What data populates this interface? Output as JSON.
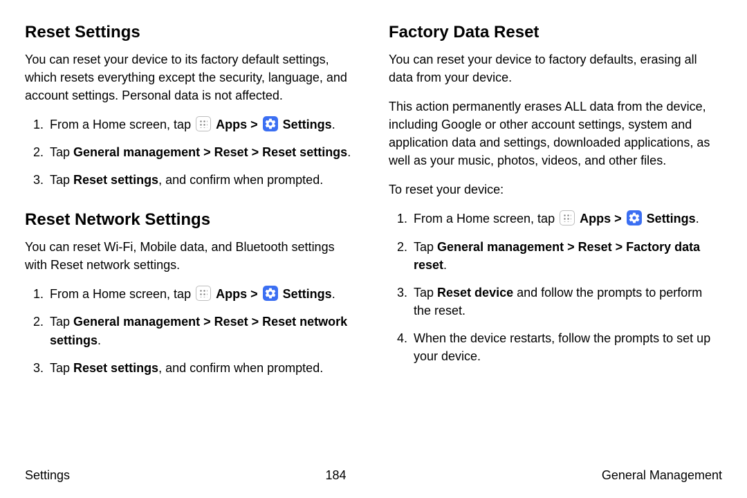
{
  "left": {
    "s1": {
      "heading": "Reset Settings",
      "intro": "You can reset your device to its factory default settings, which resets everything except the security, language, and account settings. Personal data is not affected.",
      "steps": {
        "st1_pre": "From a Home screen, tap",
        "st1_apps": "Apps",
        "st1_settings": "Settings",
        "st2_pre": "Tap ",
        "st2_bold": "General management > Reset > Reset settings",
        "st3_pre": "Tap ",
        "st3_bold": "Reset settings",
        "st3_post": ", and confirm when prompted."
      }
    },
    "s2": {
      "heading": "Reset Network Settings",
      "intro": "You can reset Wi-Fi, Mobile data, and Bluetooth settings with Reset network settings.",
      "steps": {
        "st1_pre": "From a Home screen, tap",
        "st1_apps": "Apps",
        "st1_settings": "Settings",
        "st2_pre": "Tap ",
        "st2_bold": "General management > Reset > Reset network settings",
        "st3_pre": "Tap ",
        "st3_bold": "Reset settings",
        "st3_post": ", and confirm when prompted."
      }
    }
  },
  "right": {
    "heading": "Factory Data Reset",
    "intro1": "You can reset your device to factory defaults, erasing all data from your device.",
    "intro2": "This action permanently erases ALL data from the device, including Google or other account settings, system and application data and settings, downloaded applications, as well as your music, photos, videos, and other files.",
    "lead": "To reset your device:",
    "steps": {
      "st1_pre": "From a Home screen, tap",
      "st1_apps": "Apps",
      "st1_settings": "Settings",
      "st2_pre": "Tap ",
      "st2_bold": "General management > Reset > Factory data reset",
      "st3_pre": "Tap ",
      "st3_bold": "Reset device",
      "st3_post": " and follow the prompts to perform the reset.",
      "st4": "When the device restarts, follow the prompts to set up your device."
    }
  },
  "footer": {
    "left": "Settings",
    "center": "184",
    "right": "General Management"
  },
  "chevron": ">"
}
